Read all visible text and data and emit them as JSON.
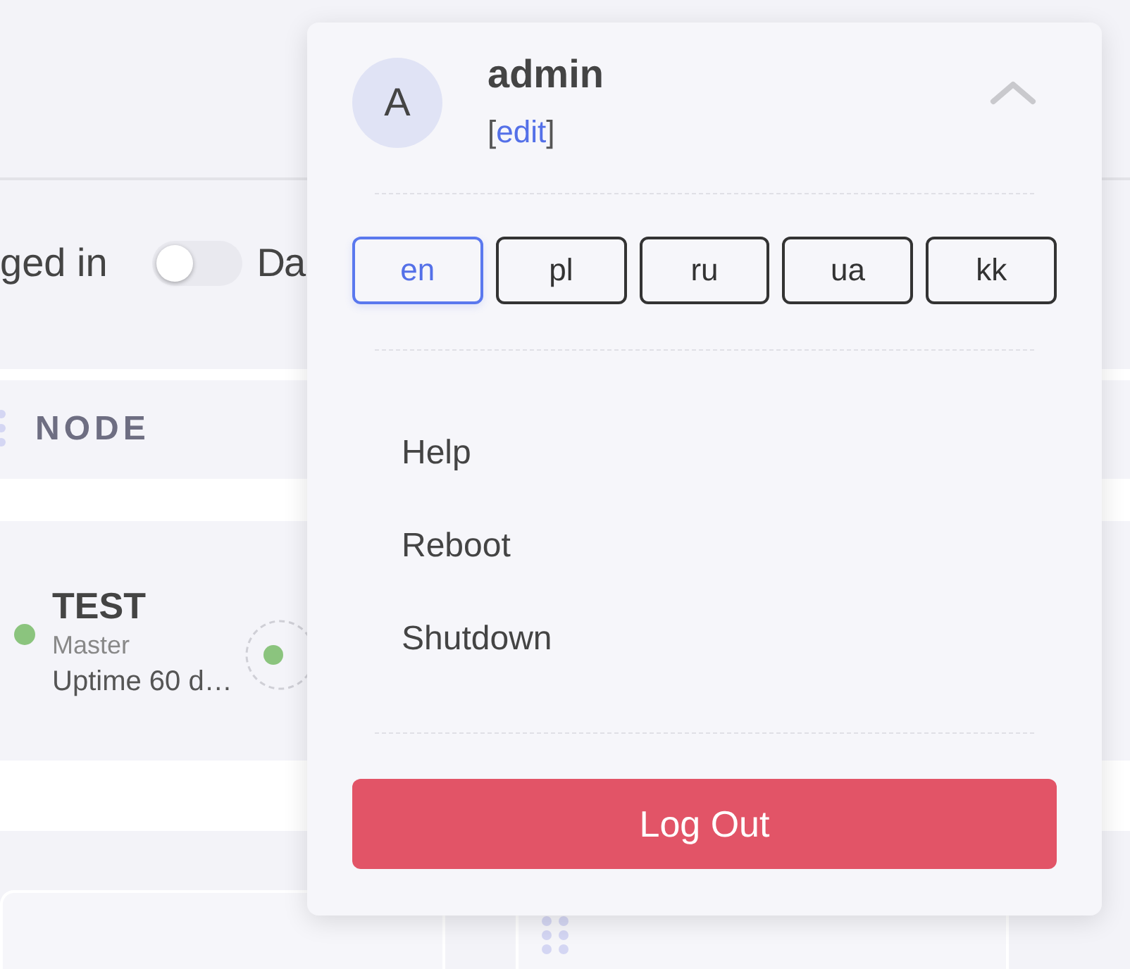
{
  "background": {
    "login_toggle": {
      "label": "ged in",
      "on": false
    },
    "next_label": "Da",
    "node_column": {
      "header": "NODE",
      "node": {
        "name": "TEST",
        "role": "Master",
        "uptime": "Uptime 60 d…"
      }
    }
  },
  "user_menu": {
    "avatar": "A",
    "username": "admin",
    "edit_link": {
      "before": "[",
      "label": "edit",
      "after": "]"
    },
    "expanded": true,
    "languages": [
      {
        "label": "en",
        "selected": true
      },
      {
        "label": "pl",
        "selected": false
      },
      {
        "label": "ru",
        "selected": false
      },
      {
        "label": "ua",
        "selected": false
      },
      {
        "label": "kk",
        "selected": false
      }
    ],
    "items": [
      "Help",
      "Reboot",
      "Shutdown"
    ],
    "logout": "Log Out"
  }
}
